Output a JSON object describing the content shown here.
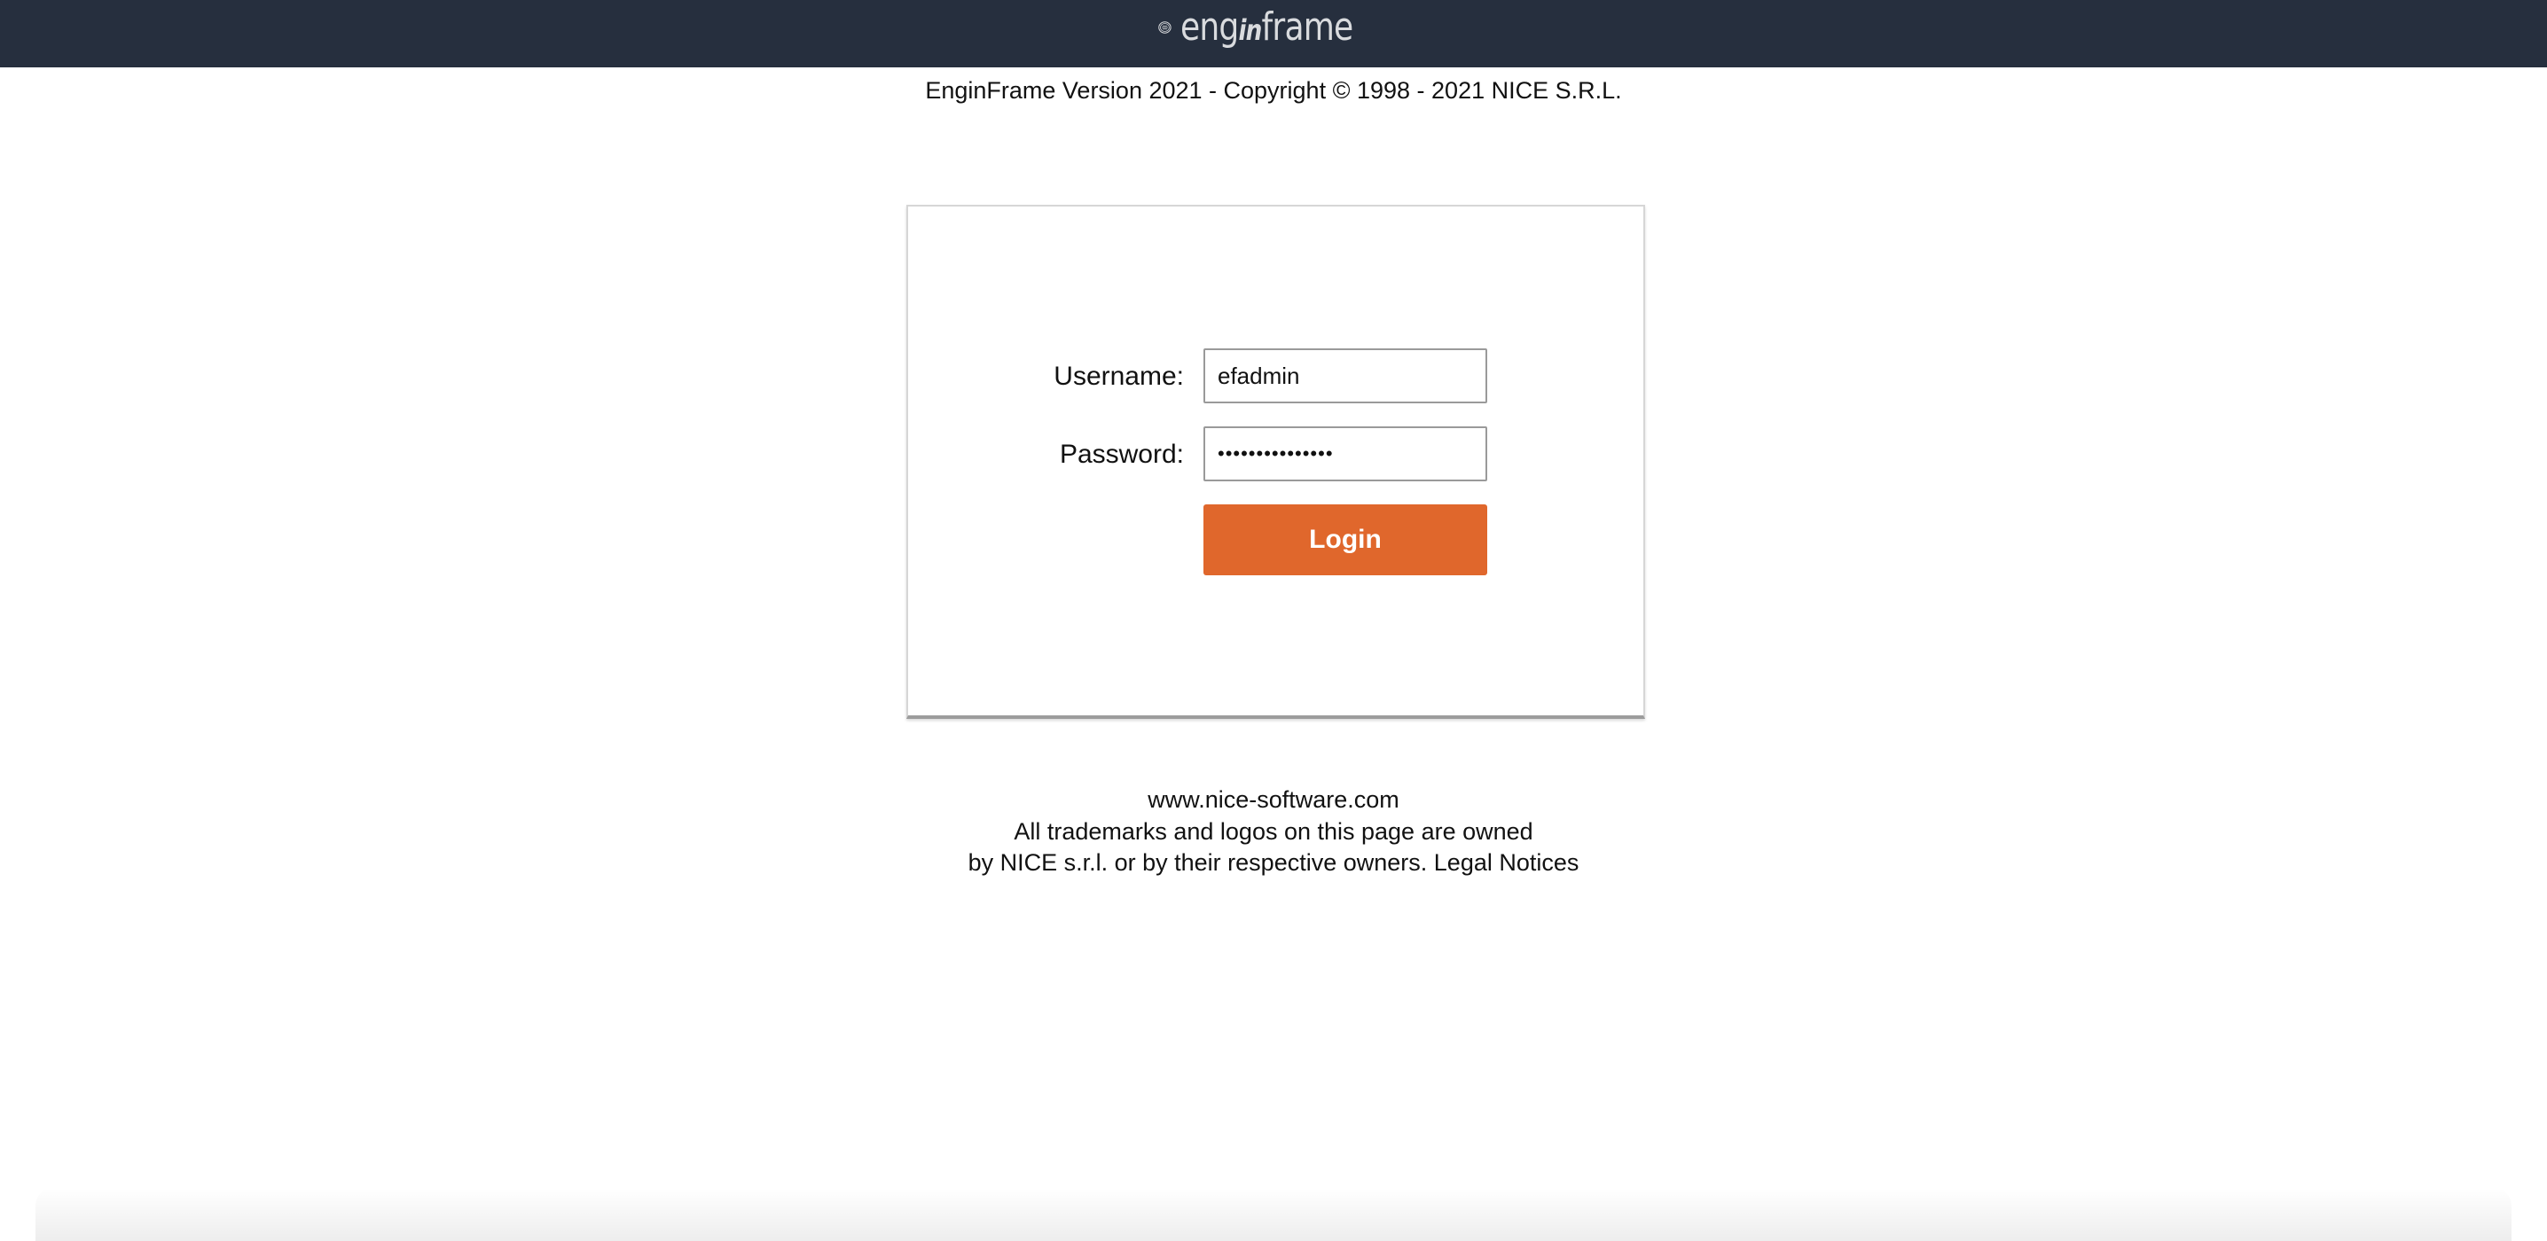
{
  "header": {
    "logo_text_left": "eng",
    "logo_text_mid": "in",
    "logo_text_right": "frame",
    "bar_color": "#262f3e"
  },
  "version_line": "EnginFrame Version 2021 - Copyright © 1998 - 2021 NICE S.R.L.",
  "login_form": {
    "username_label": "Username:",
    "username_value": "efadmin",
    "password_label": "Password:",
    "password_value": "•••••••••••••••",
    "login_button": "Login",
    "button_color": "#e0672c"
  },
  "footer": {
    "website": "www.nice-software.com",
    "line2": "All trademarks and logos on this page are owned",
    "line3_prefix": "by NICE s.r.l. or by their respective owners. ",
    "legal_link": "Legal Notices"
  }
}
